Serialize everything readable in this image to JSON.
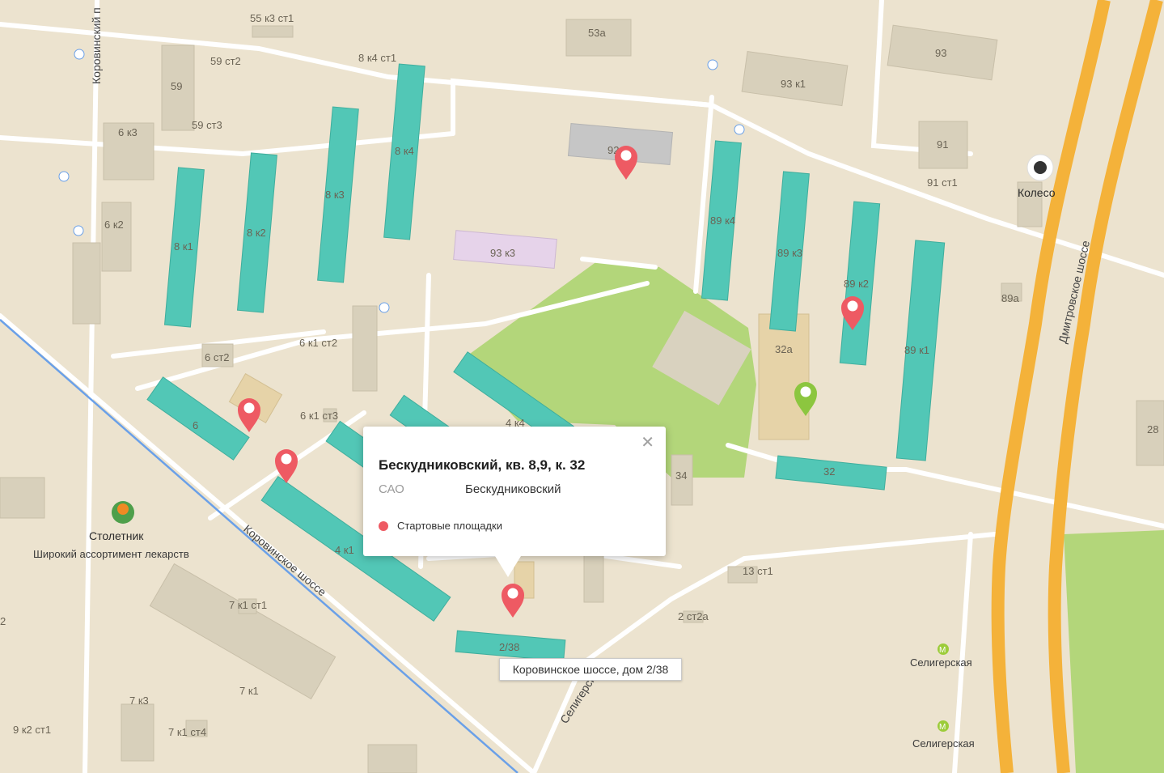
{
  "popup": {
    "title": "Бескудниковский, кв. 8,9, к. 32",
    "okrug": "САО",
    "district": "Бескудниковский",
    "legend_label": "Стартовые площадки",
    "legend_color": "#ee5a63",
    "close_icon": "close-icon"
  },
  "tooltip": {
    "text": "Коровинское шоссе, дом 2/38"
  },
  "roads": {
    "korovinsky_proezd": "Коровинский п",
    "korovinskoe_shosse": "Коровинское шоссе",
    "dmitrovskoe_shosse": "Дмитровское шоссе",
    "seligerskaya_street": "Селигерска"
  },
  "pois": {
    "stoletnik_name": "Столетник",
    "stoletnik_desc": "Широкий ассортимент лекарств",
    "koleso_name": "Колесо",
    "metro_1": "Селигерская",
    "metro_2": "Селигерская"
  },
  "buildings": {
    "b_55k3st1": "55 к3 ст1",
    "b_53a": "53а",
    "b_93": "93",
    "b_8k4st1": "8 к4 ст1",
    "b_59st2": "59 ст2",
    "b_59": "59",
    "b_59st3": "59 ст3",
    "b_93k1": "93 к1",
    "b_6k3": "6 к3",
    "b_92": "92",
    "b_91": "91",
    "b_91st1": "91 ст1",
    "b_8k4": "8 к4",
    "b_8k3": "8 к3",
    "b_8k2": "8 к2",
    "b_8k1": "8 к1",
    "b_6k2": "6 к2",
    "b_93k3": "93 к3",
    "b_89k4": "89 к4",
    "b_89k3": "89 к3",
    "b_89k2": "89 к2",
    "b_89a": "89а",
    "b_89k1": "89 к1",
    "b_32a": "32а",
    "b_6k1st2": "6 к1 ст2",
    "b_6st2": "6 ст2",
    "b_6": "6",
    "b_6k1st3": "6 к1 ст3",
    "b_4k4": "4 к4",
    "b_34": "34",
    "b_32": "32",
    "b_28": "28",
    "b_4k1": "4 к1",
    "b_13st1": "13 ст1",
    "b_7k1st1": "7 к1 ст1",
    "b_2st2a": "2 ст2а",
    "b_2_38": "2/38",
    "b_7k1": "7 к1",
    "b_7k3": "7 к3",
    "b_9k2st1": "9 к2 ст1",
    "b_7k1st4": "7 к1 ст4",
    "b_2": "2"
  }
}
